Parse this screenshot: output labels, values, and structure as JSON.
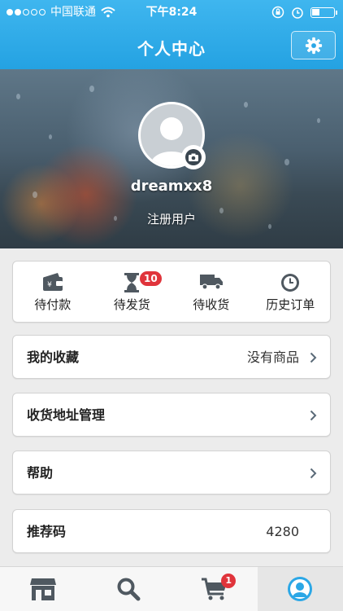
{
  "status_bar": {
    "carrier": "中国联通",
    "time": "下午8:24",
    "battery_level": 0.35
  },
  "nav": {
    "title": "个人中心",
    "settings_icon": "gear-icon"
  },
  "profile": {
    "username": "dreamxx8",
    "role": "注册用户",
    "avatar_icon": "user-silhouette-icon",
    "camera_icon": "camera-icon"
  },
  "orders": [
    {
      "label": "待付款",
      "icon": "wallet-icon",
      "badge": ""
    },
    {
      "label": "待发货",
      "icon": "hourglass-icon",
      "badge": "10"
    },
    {
      "label": "待收货",
      "icon": "truck-icon",
      "badge": ""
    },
    {
      "label": "历史订单",
      "icon": "clock-icon",
      "badge": ""
    }
  ],
  "menu": {
    "favorites": {
      "label": "我的收藏",
      "value": "没有商品"
    },
    "address": {
      "label": "收货地址管理"
    },
    "help": {
      "label": "帮助"
    },
    "referral": {
      "label": "推荐码",
      "value": "4280"
    }
  },
  "tabbar": {
    "tabs": [
      {
        "icon": "store-icon",
        "active": false
      },
      {
        "icon": "search-icon",
        "active": false
      },
      {
        "icon": "cart-icon",
        "active": false,
        "badge": "1"
      },
      {
        "icon": "profile-icon",
        "active": true
      }
    ]
  },
  "colors": {
    "accent": "#2ba7e6",
    "icon_gray": "#4f5860",
    "badge_red": "#e0343b"
  }
}
